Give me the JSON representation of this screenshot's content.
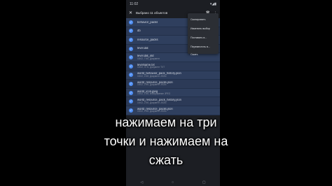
{
  "status_bar": {
    "time": "11:02",
    "right_icons": "▾◢▮"
  },
  "app_bar": {
    "close_glyph": "✕",
    "title": "Выбрано 11 объектов",
    "delete_glyph": "🗑",
    "more_glyph": "⋮"
  },
  "files": [
    {
      "name": "behavior_packs",
      "meta": ""
    },
    {
      "name": "db",
      "meta": ""
    },
    {
      "name": "resource_packs",
      "meta": ""
    },
    {
      "name": "level.dat",
      "meta": ""
    },
    {
      "name": "level.dat_old",
      "meta": "15:02, 7 Кб, Документ"
    },
    {
      "name": "levelname.txt",
      "meta": "15:02, 37 Б, Документ TXT"
    },
    {
      "name": "world_behavior_pack_history.json",
      "meta": "15:02, 2 Кб, Документ JSON"
    },
    {
      "name": "world_resource_packs.json",
      "meta": "15:02, 2 Кб, Документ JSON"
    },
    {
      "name": "world_icon.jpeg",
      "meta": "15:02, 1 Кб, Изображение JPEG"
    },
    {
      "name": "world_resource_pack_history.json",
      "meta": "15:02, 2 Кб, Документ JSON"
    },
    {
      "name": "world_resource_packs.json",
      "meta": "15:02, 2 Кб, Документ JSON"
    }
  ],
  "menu": {
    "items": [
      "Скопировать",
      "Изменить выбор",
      "Поставить в...",
      "Переместить в...",
      "Сжать"
    ]
  },
  "caption": {
    "line1": "нажимаем на три",
    "line2": "точки и нажимаем на",
    "line3": "сжать"
  },
  "nav": {
    "back": "◁",
    "home": "○",
    "recents": "▢"
  }
}
